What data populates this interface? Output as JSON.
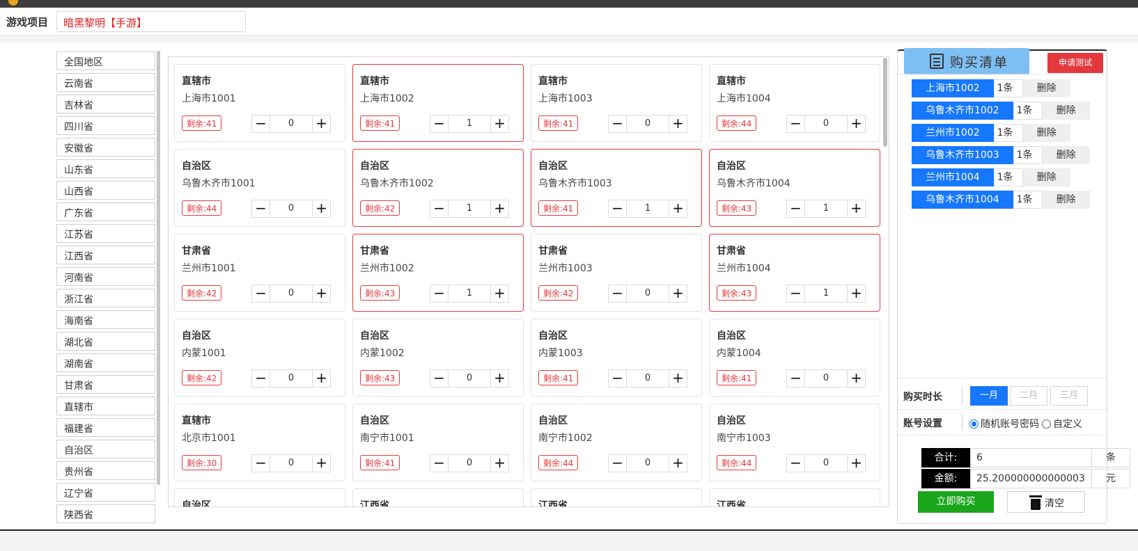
{
  "topbar": {
    "marquee": ""
  },
  "game": {
    "label": "游戏项目",
    "value": "暗黑黎明【手游】"
  },
  "regions": [
    "全国地区",
    "云南省",
    "吉林省",
    "四川省",
    "安徽省",
    "山东省",
    "山西省",
    "广东省",
    "江苏省",
    "江西省",
    "河南省",
    "浙江省",
    "海南省",
    "湖北省",
    "湖南省",
    "甘肃省",
    "直辖市",
    "福建省",
    "自治区",
    "贵州省",
    "辽宁省",
    "陕西省"
  ],
  "remaining_prefix": "剩余:",
  "stepper": {
    "minus": "−",
    "plus": "+"
  },
  "cards": [
    {
      "prov": "直辖市",
      "city": "上海市1001",
      "remain": "41",
      "qty": "0",
      "selected": false
    },
    {
      "prov": "直辖市",
      "city": "上海市1002",
      "remain": "41",
      "qty": "1",
      "selected": true
    },
    {
      "prov": "直辖市",
      "city": "上海市1003",
      "remain": "41",
      "qty": "0",
      "selected": false
    },
    {
      "prov": "直辖市",
      "city": "上海市1004",
      "remain": "44",
      "qty": "0",
      "selected": false
    },
    {
      "prov": "自治区",
      "city": "乌鲁木齐市1001",
      "remain": "44",
      "qty": "0",
      "selected": false
    },
    {
      "prov": "自治区",
      "city": "乌鲁木齐市1002",
      "remain": "42",
      "qty": "1",
      "selected": true
    },
    {
      "prov": "自治区",
      "city": "乌鲁木齐市1003",
      "remain": "41",
      "qty": "1",
      "selected": true
    },
    {
      "prov": "自治区",
      "city": "乌鲁木齐市1004",
      "remain": "43",
      "qty": "1",
      "selected": true
    },
    {
      "prov": "甘肃省",
      "city": "兰州市1001",
      "remain": "42",
      "qty": "0",
      "selected": false
    },
    {
      "prov": "甘肃省",
      "city": "兰州市1002",
      "remain": "43",
      "qty": "1",
      "selected": true
    },
    {
      "prov": "甘肃省",
      "city": "兰州市1003",
      "remain": "42",
      "qty": "0",
      "selected": false
    },
    {
      "prov": "甘肃省",
      "city": "兰州市1004",
      "remain": "43",
      "qty": "1",
      "selected": true
    },
    {
      "prov": "自治区",
      "city": "内蒙1001",
      "remain": "42",
      "qty": "0",
      "selected": false
    },
    {
      "prov": "自治区",
      "city": "内蒙1002",
      "remain": "43",
      "qty": "0",
      "selected": false
    },
    {
      "prov": "自治区",
      "city": "内蒙1003",
      "remain": "41",
      "qty": "0",
      "selected": false
    },
    {
      "prov": "自治区",
      "city": "内蒙1004",
      "remain": "41",
      "qty": "0",
      "selected": false
    },
    {
      "prov": "直辖市",
      "city": "北京市1001",
      "remain": "30",
      "qty": "0",
      "selected": false
    },
    {
      "prov": "自治区",
      "city": "南宁市1001",
      "remain": "41",
      "qty": "0",
      "selected": false
    },
    {
      "prov": "自治区",
      "city": "南宁市1002",
      "remain": "44",
      "qty": "0",
      "selected": false
    },
    {
      "prov": "自治区",
      "city": "南宁市1003",
      "remain": "44",
      "qty": "0",
      "selected": false
    },
    {
      "prov": "自治区",
      "city": "",
      "remain": "",
      "qty": "",
      "selected": false
    },
    {
      "prov": "江西省",
      "city": "",
      "remain": "",
      "qty": "",
      "selected": false
    },
    {
      "prov": "江西省",
      "city": "",
      "remain": "",
      "qty": "",
      "selected": false
    },
    {
      "prov": "江西省",
      "city": "",
      "remain": "",
      "qty": "",
      "selected": false
    }
  ],
  "cart": {
    "title": "购买清单",
    "apply_label": "申请测试",
    "delete_label": "删除",
    "items": [
      {
        "name": "上海市1002",
        "count": "1条"
      },
      {
        "name": "乌鲁木齐市1002",
        "count": "1条"
      },
      {
        "name": "兰州市1002",
        "count": "1条"
      },
      {
        "name": "乌鲁木齐市1003",
        "count": "1条"
      },
      {
        "name": "兰州市1004",
        "count": "1条"
      },
      {
        "name": "乌鲁木齐市1004",
        "count": "1条"
      }
    ]
  },
  "duration": {
    "label": "购买时长",
    "options": [
      "一月",
      "二月",
      "三月"
    ],
    "selected": "一月"
  },
  "account": {
    "label": "账号设置",
    "options": [
      "随机账号密码",
      "自定义"
    ],
    "selected": "随机账号密码"
  },
  "summary": {
    "total_label": "合计:",
    "total_value": "6",
    "total_unit": "条",
    "amount_label": "金额:",
    "amount_value": "25.200000000000003",
    "amount_unit": "元"
  },
  "actions": {
    "buy_label": "立即购买",
    "clear_label": "清空"
  },
  "colors": {
    "accent": "#1677ff",
    "danger": "#e4393c",
    "buy": "#1aa61a",
    "cart_header": "#7ebff3"
  }
}
